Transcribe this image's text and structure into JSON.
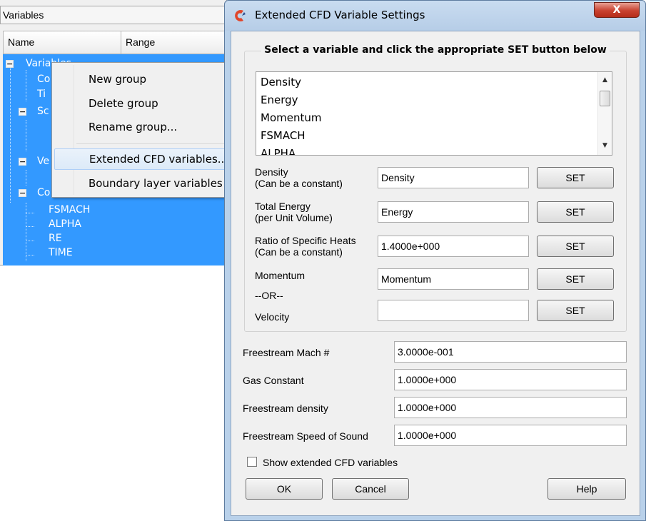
{
  "vars_panel": {
    "title": "Variables",
    "columns": [
      "Name",
      "Range"
    ],
    "tree": [
      {
        "label": "Variables",
        "level": 0,
        "expander": "−"
      },
      {
        "label": "Co",
        "level": 1
      },
      {
        "label": "Ti",
        "level": 1
      },
      {
        "label": "Sc",
        "level": 0,
        "expander": "−"
      },
      {
        "label": "",
        "level": 1
      },
      {
        "label": "",
        "level": 1
      },
      {
        "label": "Ve",
        "level": 0,
        "expander": "−"
      },
      {
        "label": "",
        "level": 1
      },
      {
        "label": "Co",
        "level": 0,
        "expander": "−"
      },
      {
        "label": "FSMACH",
        "level": 1
      },
      {
        "label": "ALPHA",
        "level": 1
      },
      {
        "label": "RE",
        "level": 1
      },
      {
        "label": "TIME",
        "level": 1
      }
    ]
  },
  "context_menu": {
    "items": [
      "New group",
      "Delete group",
      "Rename group...",
      "Extended CFD variables...",
      "Boundary layer variables"
    ]
  },
  "dialog": {
    "title": "Extended CFD Variable Settings",
    "close_label": "X",
    "group_title": "Select a variable and click the appropriate SET button below",
    "list_items": [
      "Density",
      "Energy",
      "Momentum",
      "FSMACH",
      "ALPHA"
    ],
    "fields": {
      "density_label": "Density",
      "density_sub": "(Can be a constant)",
      "density_value": "Density",
      "energy_label": "Total Energy",
      "energy_sub": "(per Unit Volume)",
      "energy_value": "Energy",
      "ratio_label": "Ratio of Specific Heats",
      "ratio_sub": "(Can be a constant)",
      "ratio_value": "1.4000e+000",
      "momentum_label": "Momentum",
      "momentum_value": "Momentum",
      "or_label": "--OR--",
      "velocity_label": "Velocity",
      "velocity_value": "",
      "set_label": "SET"
    },
    "freestream": {
      "mach_label": "Freestream Mach #",
      "mach_value": "3.0000e-001",
      "gas_label": "Gas Constant",
      "gas_value": "1.0000e+000",
      "density_label": "Freestream density",
      "density_value": "1.0000e+000",
      "sound_label": "Freestream Speed of Sound",
      "sound_value": "1.0000e+000"
    },
    "show_extended_label": "Show extended CFD variables",
    "show_extended_checked": false,
    "ok_label": "OK",
    "cancel_label": "Cancel",
    "help_label": "Help"
  }
}
